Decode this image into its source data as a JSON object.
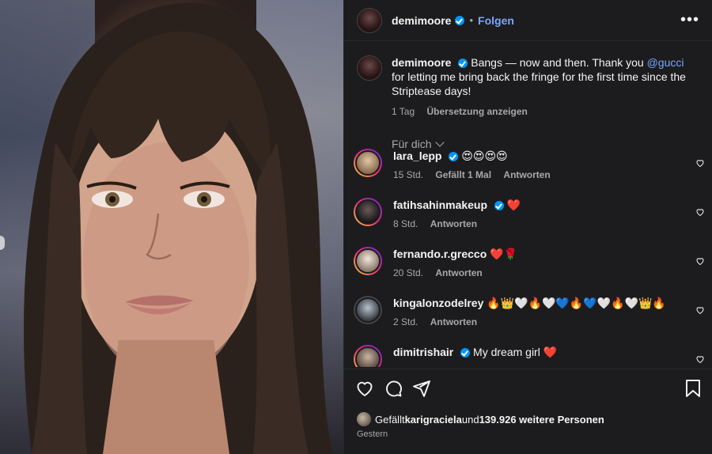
{
  "post": {
    "username": "demimoore",
    "follow_label": "Folgen",
    "dot": "•",
    "more_label": "•••"
  },
  "caption": {
    "username": "demimoore",
    "text_before": "Bangs — now and then. Thank you ",
    "mention": "@gucci",
    "text_after": " for letting me bring back the fringe for the first time since the Striptease days!",
    "time": "1 Tag",
    "translate": "Übersetzung anzeigen"
  },
  "filter": {
    "label": "Für dich"
  },
  "comments": [
    {
      "username": "lara_lepp",
      "verified": true,
      "text": "😍😍😍😍",
      "time": "15 Std.",
      "likes": "Gefällt 1 Mal",
      "reply": "Antworten"
    },
    {
      "username": "fatihsahinmakeup",
      "verified": true,
      "text": "❤️",
      "time": "8 Std.",
      "likes": "",
      "reply": "Antworten"
    },
    {
      "username": "fernando.r.grecco",
      "verified": false,
      "text": "❤️🌹",
      "time": "20 Std.",
      "likes": "",
      "reply": "Antworten"
    },
    {
      "username": "kingalonzodelrey",
      "verified": false,
      "text": "🔥👑🤍🔥🤍💙🔥💙🤍🔥🤍👑🔥",
      "time": "2 Std.",
      "likes": "",
      "reply": "Antworten"
    },
    {
      "username": "dimitrishair",
      "verified": true,
      "text": "My dream girl ❤️",
      "time": "",
      "likes": "",
      "reply": ""
    }
  ],
  "footer": {
    "likes_prefix": "Gefällt ",
    "liked_by": "karigraciela",
    "likes_middle": " und ",
    "likes_count": "139.926 weitere Personen",
    "when": "Gestern"
  },
  "colors": {
    "panel_bg": "#1c1c1e",
    "accent": "#7aa7ff",
    "verified": "#0095f6",
    "muted": "#a8a8a8"
  }
}
